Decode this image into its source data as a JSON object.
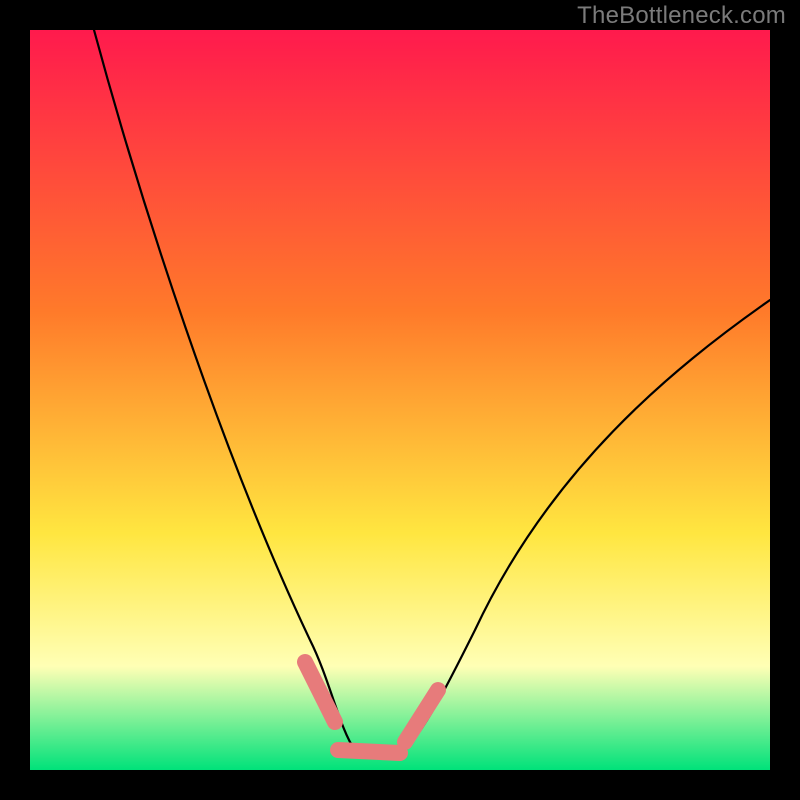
{
  "watermark": "TheBottleneck.com",
  "colors": {
    "background": "#000000",
    "watermark_text": "#7b7b7b",
    "curve": "#000000",
    "marker": "#e77b7b",
    "gradient_top": "#ff1a4d",
    "gradient_orange": "#ff7a2a",
    "gradient_yellow": "#ffe640",
    "gradient_pale": "#ffffb5",
    "gradient_green": "#00e27a"
  },
  "chart_data": {
    "type": "line",
    "title": "",
    "xlabel": "",
    "ylabel": "",
    "xlim": [
      0,
      1
    ],
    "ylim": [
      0,
      1
    ],
    "grid": false,
    "series": [
      {
        "name": "curve",
        "x": [
          0.09,
          0.12,
          0.18,
          0.26,
          0.32,
          0.37,
          0.4,
          0.44,
          0.48,
          0.5,
          0.56,
          0.63,
          0.71,
          0.8,
          0.9,
          1.0
        ],
        "y": [
          1.0,
          0.8,
          0.6,
          0.4,
          0.25,
          0.14,
          0.08,
          0.02,
          0.02,
          0.02,
          0.09,
          0.2,
          0.32,
          0.43,
          0.53,
          0.63
        ]
      }
    ],
    "markers": [
      {
        "name": "left-descending",
        "x_range": [
          0.37,
          0.41
        ],
        "y_range": [
          0.14,
          0.06
        ]
      },
      {
        "name": "valley-floor",
        "x_range": [
          0.41,
          0.5
        ],
        "y_range": [
          0.03,
          0.02
        ]
      },
      {
        "name": "right-ascending",
        "x_range": [
          0.5,
          0.55
        ],
        "y_range": [
          0.02,
          0.08
        ]
      }
    ],
    "annotations": []
  }
}
